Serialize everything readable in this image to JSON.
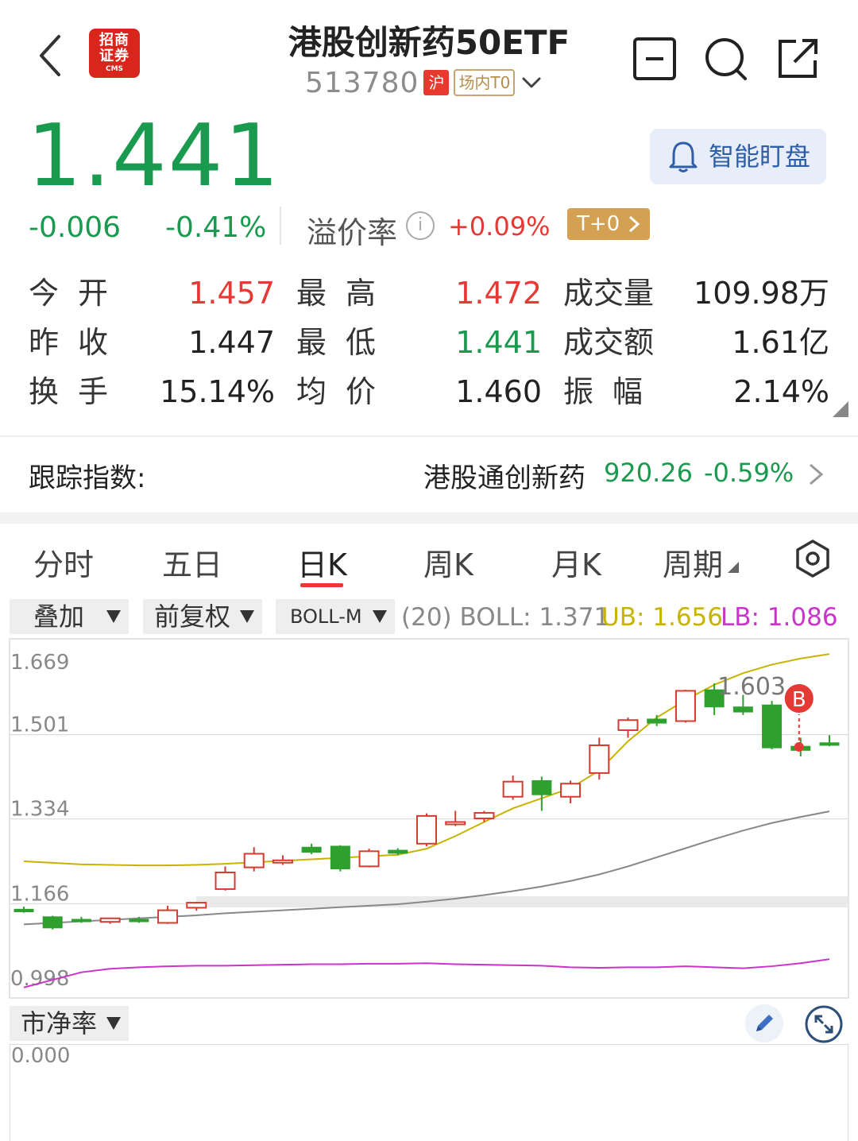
{
  "header": {
    "title": "港股创新药50ETF",
    "code": "513780",
    "exchange_tag": "沪",
    "trade_tag": "场内T0",
    "logo_text_1": "招商",
    "logo_text_2": "证券",
    "logo_sub": "CMS",
    "icons": [
      "back-icon",
      "minus-square-icon",
      "search-icon",
      "share-icon"
    ]
  },
  "quote": {
    "price": "1.441",
    "change": "-0.006",
    "change_pct": "-0.41%",
    "premium_label": "溢价率",
    "premium_value": "+0.09%",
    "t0_label": "T+0",
    "watch_label": "智能盯盘",
    "colors": {
      "up": "#e53935",
      "down": "#1a9a4f"
    }
  },
  "stats": {
    "open_label": "今开",
    "open": "1.457",
    "high_label": "最高",
    "high": "1.472",
    "volume_label": "成交量",
    "volume": "109.98万",
    "prev_close_label": "昨收",
    "prev_close": "1.447",
    "low_label": "最低",
    "low": "1.441",
    "amount_label": "成交额",
    "amount": "1.61亿",
    "turnover_label": "换手",
    "turnover": "15.14%",
    "avg_label": "均价",
    "avg": "1.460",
    "amplitude_label": "振幅",
    "amplitude": "2.14%"
  },
  "tracking": {
    "label": "跟踪指数:",
    "index_name": "港股通创新药",
    "index_value": "920.26",
    "index_pct": "-0.59%"
  },
  "tabs": {
    "items": [
      "分时",
      "五日",
      "日K",
      "周K",
      "月K",
      "周期"
    ],
    "active": "日K"
  },
  "indicators": {
    "overlay": "叠加",
    "adjust": "前复权",
    "main": "BOLL-M",
    "boll_text": "(20) BOLL: 1.371",
    "ub_text": "UB: 1.656",
    "lb_text": "LB: 1.086",
    "colors": {
      "boll": "#888888",
      "ub": "#c8b400",
      "lb": "#cc33cc"
    }
  },
  "chart_data": {
    "type": "candlestick",
    "y_ticks": [
      "1.669",
      "1.501",
      "1.334",
      "1.166",
      "0.998"
    ],
    "ylim": [
      0.998,
      1.669
    ],
    "max_label": "1.603",
    "signal_label": "B",
    "candles": [
      {
        "o": 1.155,
        "h": 1.16,
        "l": 1.148,
        "c": 1.15
      },
      {
        "o": 1.14,
        "h": 1.142,
        "l": 1.115,
        "c": 1.118
      },
      {
        "o": 1.135,
        "h": 1.14,
        "l": 1.128,
        "c": 1.134
      },
      {
        "o": 1.13,
        "h": 1.138,
        "l": 1.126,
        "c": 1.137
      },
      {
        "o": 1.135,
        "h": 1.14,
        "l": 1.128,
        "c": 1.134
      },
      {
        "o": 1.128,
        "h": 1.162,
        "l": 1.126,
        "c": 1.153
      },
      {
        "o": 1.158,
        "h": 1.168,
        "l": 1.152,
        "c": 1.168
      },
      {
        "o": 1.195,
        "h": 1.24,
        "l": 1.192,
        "c": 1.228
      },
      {
        "o": 1.238,
        "h": 1.278,
        "l": 1.23,
        "c": 1.265
      },
      {
        "o": 1.252,
        "h": 1.262,
        "l": 1.243,
        "c": 1.252
      },
      {
        "o": 1.278,
        "h": 1.285,
        "l": 1.264,
        "c": 1.268
      },
      {
        "o": 1.28,
        "h": 1.282,
        "l": 1.23,
        "c": 1.235
      },
      {
        "o": 1.24,
        "h": 1.275,
        "l": 1.238,
        "c": 1.27
      },
      {
        "o": 1.272,
        "h": 1.276,
        "l": 1.262,
        "c": 1.266
      },
      {
        "o": 1.285,
        "h": 1.345,
        "l": 1.28,
        "c": 1.34
      },
      {
        "o": 1.327,
        "h": 1.35,
        "l": 1.32,
        "c": 1.328
      },
      {
        "o": 1.335,
        "h": 1.35,
        "l": 1.328,
        "c": 1.346
      },
      {
        "o": 1.378,
        "h": 1.42,
        "l": 1.372,
        "c": 1.408
      },
      {
        "o": 1.41,
        "h": 1.418,
        "l": 1.35,
        "c": 1.382
      },
      {
        "o": 1.378,
        "h": 1.41,
        "l": 1.365,
        "c": 1.404
      },
      {
        "o": 1.425,
        "h": 1.495,
        "l": 1.412,
        "c": 1.48
      },
      {
        "o": 1.51,
        "h": 1.535,
        "l": 1.495,
        "c": 1.53
      },
      {
        "o": 1.532,
        "h": 1.54,
        "l": 1.518,
        "c": 1.524
      },
      {
        "o": 1.528,
        "h": 1.59,
        "l": 1.525,
        "c": 1.588
      },
      {
        "o": 1.59,
        "h": 1.603,
        "l": 1.54,
        "c": 1.556
      },
      {
        "o": 1.556,
        "h": 1.58,
        "l": 1.54,
        "c": 1.546
      },
      {
        "o": 1.56,
        "h": 1.568,
        "l": 1.472,
        "c": 1.475
      },
      {
        "o": 1.478,
        "h": 1.495,
        "l": 1.458,
        "c": 1.47
      },
      {
        "o": 1.485,
        "h": 1.5,
        "l": 1.478,
        "c": 1.48
      }
    ],
    "boll_mid": [
      1.125,
      1.128,
      1.131,
      1.134,
      1.137,
      1.14,
      1.143,
      1.147,
      1.15,
      1.153,
      1.156,
      1.159,
      1.162,
      1.165,
      1.17,
      1.176,
      1.183,
      1.191,
      1.2,
      1.211,
      1.224,
      1.24,
      1.258,
      1.276,
      1.294,
      1.311,
      1.326,
      1.338,
      1.349
    ],
    "boll_ub": [
      1.25,
      1.247,
      1.244,
      1.243,
      1.242,
      1.242,
      1.243,
      1.245,
      1.248,
      1.251,
      1.254,
      1.257,
      1.26,
      1.263,
      1.275,
      1.3,
      1.328,
      1.355,
      1.375,
      1.395,
      1.43,
      1.488,
      1.535,
      1.57,
      1.6,
      1.623,
      1.64,
      1.652,
      1.661
    ],
    "boll_lb": [
      1.0,
      1.015,
      1.03,
      1.037,
      1.04,
      1.042,
      1.043,
      1.043,
      1.044,
      1.045,
      1.046,
      1.046,
      1.047,
      1.047,
      1.048,
      1.046,
      1.045,
      1.044,
      1.043,
      1.04,
      1.039,
      1.04,
      1.04,
      1.042,
      1.04,
      1.038,
      1.042,
      1.048,
      1.056
    ],
    "sub_indicator": "市净率",
    "sub_value": "0.000"
  }
}
